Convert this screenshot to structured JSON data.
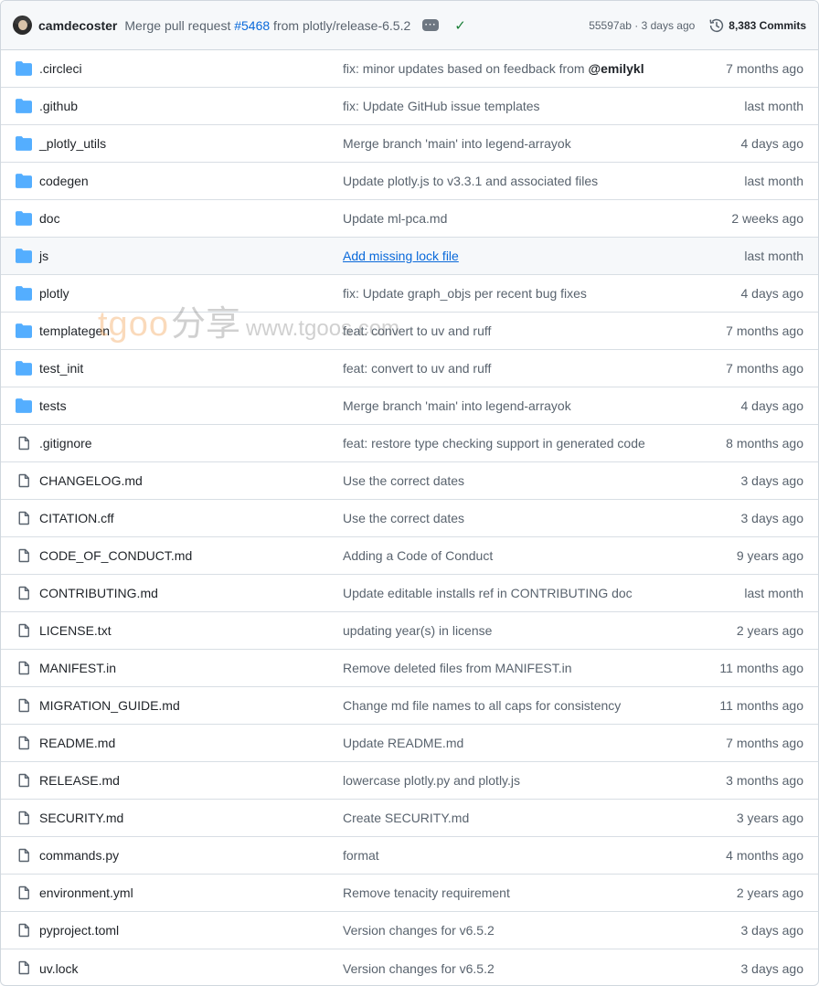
{
  "commit_bar": {
    "author": "camdecoster",
    "message_prefix": "Merge pull request ",
    "pr_link": "#5468",
    "message_suffix": " from plotly/release-6.5.2",
    "sha_and_time": "55597ab · 3 days ago",
    "commits_count": "8,383 Commits"
  },
  "watermark": {
    "brand": "tgoo",
    "brand_cn": "分享",
    "url": "www.tgoos.com"
  },
  "colors": {
    "folder": "#54aeff",
    "link": "#0969da",
    "check": "#1a7f37"
  },
  "files": [
    {
      "type": "folder",
      "name": ".circleci",
      "message": "fix: minor updates based on feedback from ",
      "mention": "@emilykl",
      "date": "7 months ago"
    },
    {
      "type": "folder",
      "name": ".github",
      "message": "fix: Update GitHub issue templates",
      "date": "last month"
    },
    {
      "type": "folder",
      "name": "_plotly_utils",
      "message": "Merge branch 'main' into legend-arrayok",
      "date": "4 days ago"
    },
    {
      "type": "folder",
      "name": "codegen",
      "message": "Update plotly.js to v3.3.1 and associated files",
      "date": "last month"
    },
    {
      "type": "folder",
      "name": "doc",
      "message": "Update ml-pca.md",
      "date": "2 weeks ago"
    },
    {
      "type": "folder",
      "name": "js",
      "message": "Add missing lock file",
      "date": "last month",
      "hover": true
    },
    {
      "type": "folder",
      "name": "plotly",
      "message": "fix: Update graph_objs per recent bug fixes",
      "date": "4 days ago"
    },
    {
      "type": "folder",
      "name": "templategen",
      "message": "feat: convert to uv and ruff",
      "date": "7 months ago"
    },
    {
      "type": "folder",
      "name": "test_init",
      "message": "feat: convert to uv and ruff",
      "date": "7 months ago"
    },
    {
      "type": "folder",
      "name": "tests",
      "message": "Merge branch 'main' into legend-arrayok",
      "date": "4 days ago"
    },
    {
      "type": "file",
      "name": ".gitignore",
      "message": "feat: restore type checking support in generated code",
      "date": "8 months ago"
    },
    {
      "type": "file",
      "name": "CHANGELOG.md",
      "message": "Use the correct dates",
      "date": "3 days ago"
    },
    {
      "type": "file",
      "name": "CITATION.cff",
      "message": "Use the correct dates",
      "date": "3 days ago"
    },
    {
      "type": "file",
      "name": "CODE_OF_CONDUCT.md",
      "message": "Adding a Code of Conduct",
      "date": "9 years ago"
    },
    {
      "type": "file",
      "name": "CONTRIBUTING.md",
      "message": "Update editable installs ref in CONTRIBUTING doc",
      "date": "last month"
    },
    {
      "type": "file",
      "name": "LICENSE.txt",
      "message": "updating year(s) in license",
      "date": "2 years ago"
    },
    {
      "type": "file",
      "name": "MANIFEST.in",
      "message": "Remove deleted files from MANIFEST.in",
      "date": "11 months ago"
    },
    {
      "type": "file",
      "name": "MIGRATION_GUIDE.md",
      "message": "Change md file names to all caps for consistency",
      "date": "11 months ago"
    },
    {
      "type": "file",
      "name": "README.md",
      "message": "Update README.md",
      "date": "7 months ago"
    },
    {
      "type": "file",
      "name": "RELEASE.md",
      "message": "lowercase plotly.py and plotly.js",
      "date": "3 months ago"
    },
    {
      "type": "file",
      "name": "SECURITY.md",
      "message": "Create SECURITY.md",
      "date": "3 years ago"
    },
    {
      "type": "file",
      "name": "commands.py",
      "message": "format",
      "date": "4 months ago"
    },
    {
      "type": "file",
      "name": "environment.yml",
      "message": "Remove tenacity requirement",
      "date": "2 years ago"
    },
    {
      "type": "file",
      "name": "pyproject.toml",
      "message": "Version changes for v6.5.2",
      "date": "3 days ago"
    },
    {
      "type": "file",
      "name": "uv.lock",
      "message": "Version changes for v6.5.2",
      "date": "3 days ago"
    }
  ]
}
